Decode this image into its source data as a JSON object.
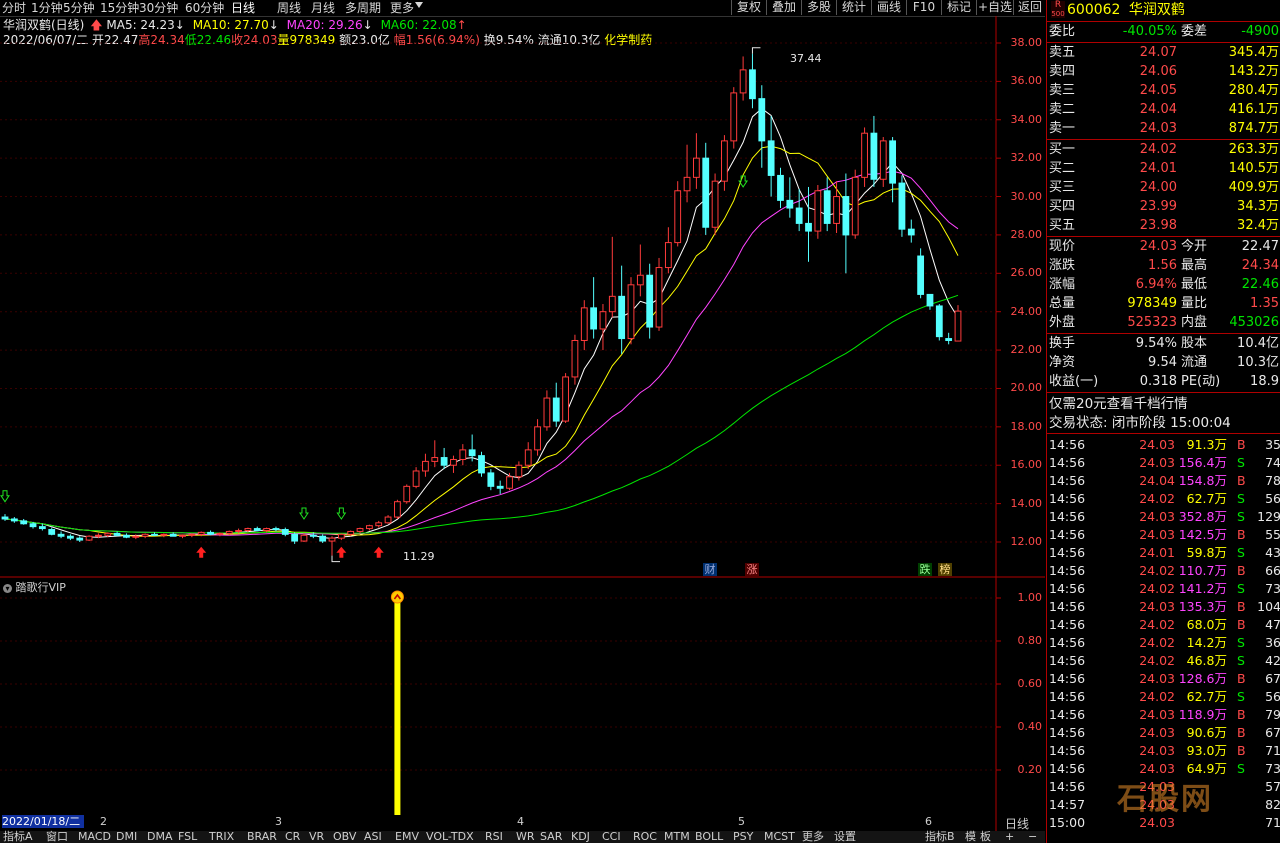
{
  "toolbar": {
    "periods": [
      "分时",
      "1分钟",
      "5分钟",
      "15分钟",
      "30分钟",
      "60分钟",
      "日线",
      "周线",
      "月线",
      "多周期",
      "更多"
    ],
    "active_period": "日线",
    "buttons": [
      "复权",
      "叠加",
      "多股",
      "统计",
      "画线",
      "F10",
      "标记",
      "+自选",
      "返回"
    ]
  },
  "info": {
    "stock_title": "华润双鹤(日线)",
    "ma5": "MA5: 24.23",
    "ma10": "MA10: 27.70",
    "ma20": "MA20: 29.26",
    "ma60": "MA60: 22.08",
    "date": "2022/06/07/二",
    "open": "开22.47",
    "high": "高24.34",
    "low": "低22.46",
    "close": "收24.03",
    "volume": "量978349",
    "amount": "额23.0亿",
    "change": "幅1.56(6.94%)",
    "turnover": "换9.54%",
    "float": "流通10.3亿",
    "sector": "化学制药"
  },
  "chart_labels": {
    "max_price": "37.44",
    "min_price": "11.29",
    "event_cai": "财",
    "event_zhang": "涨",
    "event_die": "跌",
    "event_bang": "榜",
    "indicator_name": "踏歌行VIP",
    "cursor_date": "2022/01/18/二",
    "months": [
      "2",
      "3",
      "4",
      "5",
      "6"
    ],
    "period_label": "日线",
    "r_label": "R",
    "r_sub": "500"
  },
  "y_axis_main": [
    "38.00",
    "36.00",
    "34.00",
    "32.00",
    "30.00",
    "28.00",
    "26.00",
    "24.00",
    "22.00",
    "20.00",
    "18.00",
    "16.00",
    "14.00",
    "12.00"
  ],
  "y_axis_sub": [
    "1.00",
    "0.80",
    "0.60",
    "0.40",
    "0.20"
  ],
  "indicators": [
    "指标A",
    "窗口",
    "MACD",
    "DMI",
    "DMA",
    "FSL",
    "TRIX",
    "BRAR",
    "CR",
    "VR",
    "OBV",
    "ASI",
    "EMV",
    "VOL-TDX",
    "RSI",
    "WR",
    "SAR",
    "KDJ",
    "CCI",
    "ROC",
    "MTM",
    "BOLL",
    "PSY",
    "MCST",
    "更多",
    "设置"
  ],
  "indicator_b": "指标B",
  "indicator_tail": [
    "模",
    "板",
    "+",
    "−"
  ],
  "quote": {
    "code": "600062",
    "name": "华润双鹤",
    "weibi_label": "委比",
    "weibi": "-40.05%",
    "weicha_label": "委差",
    "weicha": "-4900",
    "asks": [
      {
        "label": "卖五",
        "price": "24.07",
        "vol": "345.4万"
      },
      {
        "label": "卖四",
        "price": "24.06",
        "vol": "143.2万"
      },
      {
        "label": "卖三",
        "price": "24.05",
        "vol": "280.4万"
      },
      {
        "label": "卖二",
        "price": "24.04",
        "vol": "416.1万"
      },
      {
        "label": "卖一",
        "price": "24.03",
        "vol": "874.7万"
      }
    ],
    "bids": [
      {
        "label": "买一",
        "price": "24.02",
        "vol": "263.3万"
      },
      {
        "label": "买二",
        "price": "24.01",
        "vol": "140.5万"
      },
      {
        "label": "买三",
        "price": "24.00",
        "vol": "409.9万"
      },
      {
        "label": "买四",
        "price": "23.99",
        "vol": "34.3万"
      },
      {
        "label": "买五",
        "price": "23.98",
        "vol": "32.4万"
      }
    ],
    "stats": [
      {
        "l1": "现价",
        "v1": "24.03",
        "l2": "今开",
        "v2": "22.47"
      },
      {
        "l1": "涨跌",
        "v1": "1.56",
        "l2": "最高",
        "v2": "24.34"
      },
      {
        "l1": "涨幅",
        "v1": "6.94%",
        "l2": "最低",
        "v2": "22.46"
      },
      {
        "l1": "总量",
        "v1": "978349",
        "l2": "量比",
        "v2": "1.35"
      },
      {
        "l1": "外盘",
        "v1": "525323",
        "l2": "内盘",
        "v2": "453026"
      }
    ],
    "stats2": [
      {
        "l1": "换手",
        "v1": "9.54%",
        "l2": "股本",
        "v2": "10.4亿"
      },
      {
        "l1": "净资",
        "v1": "9.54",
        "l2": "流通",
        "v2": "10.3亿"
      },
      {
        "l1": "收益(一)",
        "v1": "0.318",
        "l2": "PE(动)",
        "v2": "18.9"
      }
    ],
    "promo": "仅需20元查看千档行情",
    "status": "交易状态: 闭市阶段 15:00:04"
  },
  "ticks": [
    {
      "t": "14:56",
      "p": "24.03",
      "v": "91.3万",
      "s": "B",
      "n": "35"
    },
    {
      "t": "14:56",
      "p": "24.03",
      "v": "156.4万",
      "s": "S",
      "n": "74"
    },
    {
      "t": "14:56",
      "p": "24.04",
      "v": "154.8万",
      "s": "B",
      "n": "78"
    },
    {
      "t": "14:56",
      "p": "24.02",
      "v": "62.7万",
      "s": "S",
      "n": "56"
    },
    {
      "t": "14:56",
      "p": "24.03",
      "v": "352.8万",
      "s": "S",
      "n": "129"
    },
    {
      "t": "14:56",
      "p": "24.03",
      "v": "142.5万",
      "s": "B",
      "n": "55"
    },
    {
      "t": "14:56",
      "p": "24.01",
      "v": "59.8万",
      "s": "S",
      "n": "43"
    },
    {
      "t": "14:56",
      "p": "24.02",
      "v": "110.7万",
      "s": "B",
      "n": "66"
    },
    {
      "t": "14:56",
      "p": "24.02",
      "v": "141.2万",
      "s": "S",
      "n": "73"
    },
    {
      "t": "14:56",
      "p": "24.03",
      "v": "135.3万",
      "s": "B",
      "n": "104"
    },
    {
      "t": "14:56",
      "p": "24.02",
      "v": "68.0万",
      "s": "B",
      "n": "47"
    },
    {
      "t": "14:56",
      "p": "24.02",
      "v": "14.2万",
      "s": "S",
      "n": "36"
    },
    {
      "t": "14:56",
      "p": "24.02",
      "v": "46.8万",
      "s": "S",
      "n": "42"
    },
    {
      "t": "14:56",
      "p": "24.03",
      "v": "128.6万",
      "s": "B",
      "n": "67"
    },
    {
      "t": "14:56",
      "p": "24.02",
      "v": "62.7万",
      "s": "S",
      "n": "56"
    },
    {
      "t": "14:56",
      "p": "24.03",
      "v": "118.9万",
      "s": "B",
      "n": "79"
    },
    {
      "t": "14:56",
      "p": "24.03",
      "v": "90.6万",
      "s": "B",
      "n": "67"
    },
    {
      "t": "14:56",
      "p": "24.03",
      "v": "93.0万",
      "s": "B",
      "n": "71"
    },
    {
      "t": "14:56",
      "p": "24.03",
      "v": "64.9万",
      "s": "S",
      "n": "73"
    },
    {
      "t": "14:56",
      "p": "24.03",
      "v": "",
      "s": "",
      "n": "57"
    },
    {
      "t": "14:57",
      "p": "24.03",
      "v": "",
      "s": "",
      "n": "82"
    },
    {
      "t": "15:00",
      "p": "24.03",
      "v": "",
      "s": "",
      "n": "71"
    }
  ],
  "watermark": "石股网",
  "chart_data": {
    "type": "candlestick",
    "title": "华润双鹤(日线)",
    "ylim": [
      11,
      39
    ],
    "candles": [
      [
        13.3,
        13.45,
        13.1,
        13.2
      ],
      [
        13.2,
        13.3,
        13.0,
        13.1
      ],
      [
        13.1,
        13.2,
        12.9,
        12.95
      ],
      [
        12.95,
        13.05,
        12.7,
        12.8
      ],
      [
        12.8,
        12.95,
        12.6,
        12.7
      ],
      [
        12.65,
        12.75,
        12.35,
        12.4
      ],
      [
        12.4,
        12.55,
        12.2,
        12.3
      ],
      [
        12.3,
        12.4,
        12.1,
        12.2
      ],
      [
        12.2,
        12.3,
        12.0,
        12.1
      ],
      [
        12.1,
        12.35,
        12.05,
        12.3
      ],
      [
        12.3,
        12.45,
        12.2,
        12.35
      ],
      [
        12.35,
        12.5,
        12.25,
        12.45
      ],
      [
        12.45,
        12.55,
        12.3,
        12.35
      ],
      [
        12.35,
        12.45,
        12.2,
        12.25
      ],
      [
        12.25,
        12.4,
        12.15,
        12.3
      ],
      [
        12.3,
        12.45,
        12.2,
        12.4
      ],
      [
        12.4,
        12.5,
        12.3,
        12.35
      ],
      [
        12.35,
        12.45,
        12.25,
        12.4
      ],
      [
        12.4,
        12.5,
        12.3,
        12.3
      ],
      [
        12.3,
        12.4,
        12.2,
        12.35
      ],
      [
        12.35,
        12.45,
        12.25,
        12.4
      ],
      [
        12.4,
        12.55,
        12.3,
        12.5
      ],
      [
        12.5,
        12.6,
        12.35,
        12.4
      ],
      [
        12.4,
        12.5,
        12.3,
        12.45
      ],
      [
        12.45,
        12.6,
        12.35,
        12.55
      ],
      [
        12.55,
        12.7,
        12.45,
        12.6
      ],
      [
        12.6,
        12.75,
        12.5,
        12.7
      ],
      [
        12.7,
        12.8,
        12.55,
        12.6
      ],
      [
        12.6,
        12.75,
        12.5,
        12.7
      ],
      [
        12.7,
        12.8,
        12.55,
        12.65
      ],
      [
        12.65,
        12.75,
        12.3,
        12.4
      ],
      [
        12.4,
        12.5,
        11.9,
        12.05
      ],
      [
        12.05,
        12.45,
        12.0,
        12.35
      ],
      [
        12.35,
        12.5,
        12.2,
        12.3
      ],
      [
        12.3,
        12.4,
        11.95,
        12.05
      ],
      [
        12.05,
        12.3,
        11.29,
        12.2
      ],
      [
        12.2,
        12.45,
        12.1,
        12.4
      ],
      [
        12.4,
        12.6,
        12.3,
        12.55
      ],
      [
        12.55,
        12.75,
        12.45,
        12.7
      ],
      [
        12.7,
        12.9,
        12.6,
        12.85
      ],
      [
        12.85,
        13.1,
        12.75,
        13.0
      ],
      [
        13.0,
        13.4,
        12.95,
        13.3
      ],
      [
        13.3,
        14.2,
        13.2,
        14.1
      ],
      [
        14.1,
        15.0,
        14.0,
        14.9
      ],
      [
        14.9,
        15.9,
        14.8,
        15.7
      ],
      [
        15.7,
        16.6,
        15.4,
        16.2
      ],
      [
        16.2,
        17.3,
        15.9,
        16.4
      ],
      [
        16.4,
        16.9,
        15.8,
        16.0
      ],
      [
        16.0,
        16.5,
        15.6,
        16.3
      ],
      [
        16.3,
        17.1,
        16.0,
        16.8
      ],
      [
        16.8,
        17.6,
        16.2,
        16.5
      ],
      [
        16.5,
        16.7,
        15.4,
        15.6
      ],
      [
        15.6,
        15.8,
        14.7,
        14.9
      ],
      [
        14.9,
        15.2,
        14.5,
        14.8
      ],
      [
        14.8,
        15.6,
        14.7,
        15.4
      ],
      [
        15.4,
        16.2,
        15.2,
        16.0
      ],
      [
        16.0,
        17.2,
        15.8,
        16.8
      ],
      [
        16.8,
        18.4,
        16.5,
        18.0
      ],
      [
        18.0,
        19.9,
        17.8,
        19.5
      ],
      [
        19.5,
        20.3,
        18.0,
        18.3
      ],
      [
        18.3,
        20.8,
        18.2,
        20.6
      ],
      [
        20.6,
        22.8,
        20.2,
        22.5
      ],
      [
        22.5,
        24.6,
        22.0,
        24.2
      ],
      [
        24.2,
        25.8,
        22.6,
        23.1
      ],
      [
        23.1,
        24.4,
        22.0,
        24.0
      ],
      [
        24.0,
        27.9,
        23.7,
        24.8
      ],
      [
        24.8,
        26.4,
        21.8,
        22.6
      ],
      [
        22.6,
        25.8,
        22.3,
        25.4
      ],
      [
        25.4,
        27.5,
        24.8,
        25.9
      ],
      [
        25.9,
        26.5,
        22.6,
        23.2
      ],
      [
        23.2,
        26.8,
        23.0,
        26.3
      ],
      [
        26.3,
        28.4,
        26.0,
        27.6
      ],
      [
        27.6,
        30.8,
        27.4,
        30.3
      ],
      [
        30.3,
        32.7,
        29.7,
        31.0
      ],
      [
        31.0,
        33.3,
        30.4,
        32.0
      ],
      [
        32.0,
        32.8,
        28.0,
        28.4
      ],
      [
        28.4,
        31.2,
        28.0,
        30.8
      ],
      [
        30.8,
        33.2,
        30.3,
        32.9
      ],
      [
        32.9,
        35.7,
        32.5,
        35.4
      ],
      [
        35.4,
        37.3,
        35.0,
        36.6
      ],
      [
        36.6,
        37.44,
        34.6,
        35.1
      ],
      [
        35.1,
        35.8,
        31.5,
        32.9
      ],
      [
        32.9,
        34.2,
        30.0,
        31.1
      ],
      [
        31.1,
        31.5,
        29.4,
        29.8
      ],
      [
        29.8,
        31.0,
        28.9,
        29.4
      ],
      [
        29.4,
        30.4,
        28.2,
        28.6
      ],
      [
        28.6,
        30.5,
        26.6,
        28.2
      ],
      [
        28.2,
        30.6,
        27.8,
        30.3
      ],
      [
        30.3,
        31.0,
        28.2,
        28.6
      ],
      [
        28.6,
        30.8,
        28.1,
        30.0
      ],
      [
        30.0,
        31.2,
        26.0,
        28.0
      ],
      [
        28.0,
        31.4,
        27.8,
        31.0
      ],
      [
        31.0,
        33.6,
        30.5,
        33.3
      ],
      [
        33.3,
        34.2,
        30.5,
        30.9
      ],
      [
        30.9,
        33.1,
        30.5,
        32.9
      ],
      [
        32.9,
        33.1,
        29.7,
        30.7
      ],
      [
        30.7,
        31.1,
        27.9,
        28.3
      ],
      [
        28.3,
        28.8,
        27.6,
        28.0
      ],
      [
        26.9,
        27.3,
        24.7,
        24.9
      ],
      [
        24.9,
        24.9,
        24.1,
        24.3
      ],
      [
        24.3,
        24.4,
        22.5,
        22.7
      ],
      [
        22.6,
        22.9,
        22.3,
        22.5
      ],
      [
        22.47,
        24.34,
        22.46,
        24.03
      ]
    ],
    "ma5_last": 24.23,
    "ma10_last": 27.7,
    "ma20_last": 29.26,
    "ma60_last": 22.08,
    "indicator": {
      "name": "踏歌行VIP",
      "ylim": [
        0,
        1.1
      ],
      "signal_index": 42,
      "signal_value": 1.0
    }
  }
}
